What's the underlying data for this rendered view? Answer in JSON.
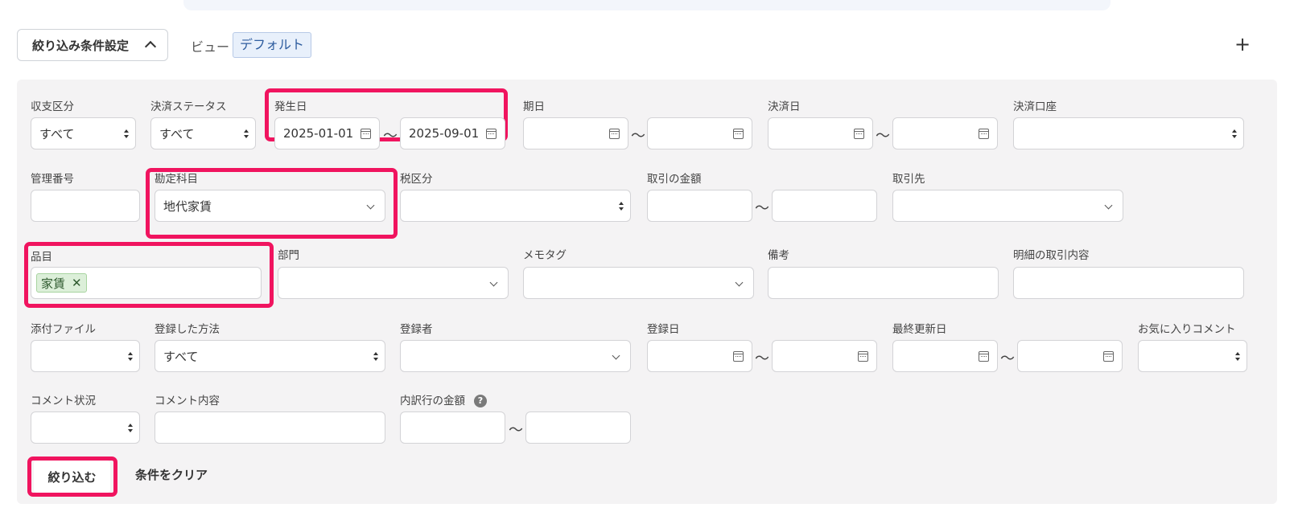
{
  "header": {
    "filter_toggle_label": "絞り込み条件設定",
    "view_label": "ビュー",
    "view_value": "デフォルト",
    "add_label": "+"
  },
  "row1": {
    "income_type": {
      "label": "収支区分",
      "value": "すべて"
    },
    "settlement_status": {
      "label": "決済ステータス",
      "value": "すべて"
    },
    "issue_date": {
      "label": "発生日",
      "from": "2025-01-01",
      "to": "2025-09-01"
    },
    "due_date": {
      "label": "期日",
      "from": "",
      "to": ""
    },
    "settlement_date": {
      "label": "決済日",
      "from": "",
      "to": ""
    },
    "settlement_account": {
      "label": "決済口座",
      "value": ""
    }
  },
  "row2": {
    "control_number": {
      "label": "管理番号",
      "value": ""
    },
    "account_item": {
      "label": "勘定科目",
      "value": "地代家賃"
    },
    "tax_category": {
      "label": "税区分",
      "value": ""
    },
    "amount": {
      "label": "取引の金額",
      "from": "",
      "to": ""
    },
    "partner": {
      "label": "取引先",
      "value": ""
    }
  },
  "row3": {
    "item": {
      "label": "品目",
      "tags": [
        "家賃"
      ],
      "remove_symbol": "✕"
    },
    "section": {
      "label": "部門",
      "value": ""
    },
    "memo_tag": {
      "label": "メモタグ",
      "value": ""
    },
    "remarks": {
      "label": "備考",
      "value": ""
    },
    "line_description": {
      "label": "明細の取引内容",
      "value": ""
    }
  },
  "row4": {
    "attachment": {
      "label": "添付ファイル",
      "value": ""
    },
    "register_method": {
      "label": "登録した方法",
      "value": "すべて"
    },
    "registrant": {
      "label": "登録者",
      "value": ""
    },
    "register_date": {
      "label": "登録日",
      "from": "",
      "to": ""
    },
    "last_updated": {
      "label": "最終更新日",
      "from": "",
      "to": ""
    },
    "favorite_comment": {
      "label": "お気に入りコメント",
      "value": ""
    }
  },
  "row5": {
    "comment_status": {
      "label": "コメント状況",
      "value": ""
    },
    "comment_content": {
      "label": "コメント内容",
      "value": ""
    },
    "breakdown_amount": {
      "label": "内訳行の金額",
      "help": "?",
      "from": "",
      "to": ""
    }
  },
  "range_separator": "〜",
  "actions": {
    "apply_label": "絞り込む",
    "clear_label": "条件をクリア"
  },
  "colors": {
    "highlight": "#f0145f",
    "panel": "#f4f3f4",
    "tag_bg": "#dcefd9"
  }
}
